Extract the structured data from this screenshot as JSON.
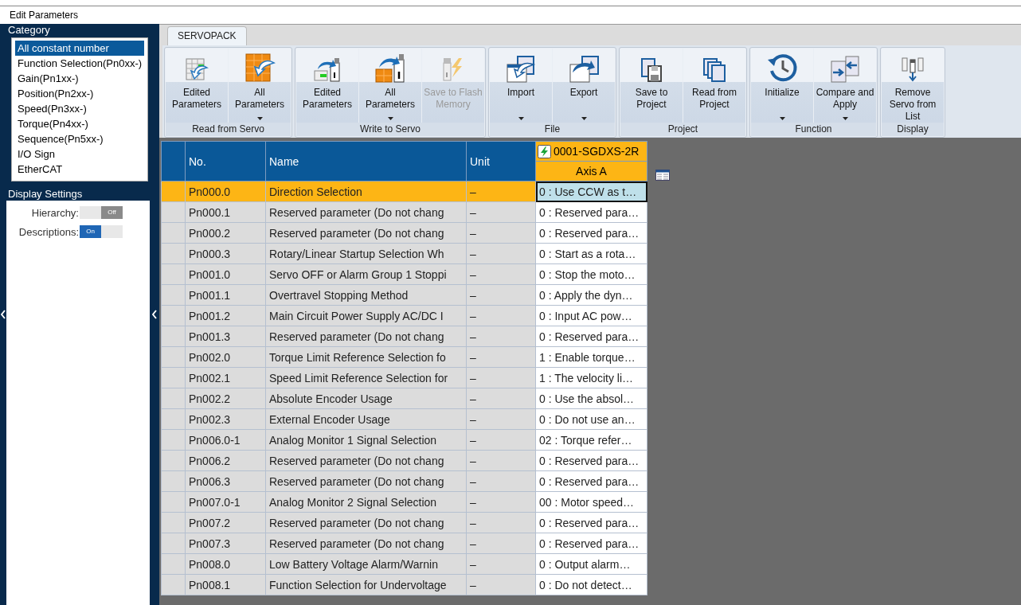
{
  "window": {
    "title": "Edit Parameters"
  },
  "sidebar": {
    "category_title": "Category",
    "categories": [
      {
        "label": "All constant number",
        "selected": true
      },
      {
        "label": "Function Selection(Pn0xx-)",
        "selected": false
      },
      {
        "label": "Gain(Pn1xx-)",
        "selected": false
      },
      {
        "label": "Position(Pn2xx-)",
        "selected": false
      },
      {
        "label": "Speed(Pn3xx-)",
        "selected": false
      },
      {
        "label": "Torque(Pn4xx-)",
        "selected": false
      },
      {
        "label": "Sequence(Pn5xx-)",
        "selected": false
      },
      {
        "label": "I/O Sign",
        "selected": false
      },
      {
        "label": "EtherCAT",
        "selected": false
      }
    ],
    "settings_title": "Display Settings",
    "settings": [
      {
        "label": "Hierarchy:",
        "on": false,
        "text": "Off"
      },
      {
        "label": "Descriptions:",
        "on": true,
        "text": "On"
      }
    ]
  },
  "ribbon": {
    "tabs": [
      {
        "label": "SERVOPACK",
        "selected": true
      }
    ],
    "groups": [
      {
        "label": "Read from Servo",
        "buttons": [
          {
            "label": "Edited Parameters",
            "has_menu": false,
            "disabled": false
          },
          {
            "label": "All Parameters",
            "has_menu": true,
            "disabled": false
          }
        ]
      },
      {
        "label": "Write to Servo",
        "buttons": [
          {
            "label": "Edited Parameters",
            "has_menu": false,
            "disabled": false
          },
          {
            "label": "All Parameters",
            "has_menu": true,
            "disabled": false
          },
          {
            "label": "Save to Flash Memory",
            "has_menu": false,
            "disabled": true
          }
        ]
      },
      {
        "label": "File",
        "buttons": [
          {
            "label": "Import",
            "has_menu": true,
            "disabled": false
          },
          {
            "label": "Export",
            "has_menu": true,
            "disabled": false
          }
        ]
      },
      {
        "label": "Project",
        "buttons": [
          {
            "label": "Save to Project",
            "has_menu": false,
            "disabled": false
          },
          {
            "label": "Read from Project",
            "has_menu": false,
            "disabled": false
          }
        ]
      },
      {
        "label": "Function",
        "buttons": [
          {
            "label": "Initialize",
            "has_menu": true,
            "disabled": false
          },
          {
            "label": "Compare and Apply",
            "has_menu": true,
            "disabled": false
          }
        ]
      },
      {
        "label": "Display",
        "buttons": [
          {
            "label": "Remove Servo from List",
            "has_menu": false,
            "disabled": false
          }
        ]
      }
    ]
  },
  "table": {
    "columns": [
      "No.",
      "Name",
      "Unit"
    ],
    "device": "0001-SGDXS-2R",
    "axis": "Axis A",
    "rows": [
      {
        "no": "Pn000.0",
        "name": "Direction Selection",
        "unit": "–",
        "value": "0 : Use CCW as t…",
        "selected": true
      },
      {
        "no": "Pn000.1",
        "name": "Reserved parameter (Do not chang",
        "unit": "–",
        "value": "0 : Reserved para…",
        "selected": false
      },
      {
        "no": "Pn000.2",
        "name": "Reserved parameter (Do not chang",
        "unit": "–",
        "value": "0 : Reserved para…",
        "selected": false
      },
      {
        "no": "Pn000.3",
        "name": "Rotary/Linear Startup Selection Wh",
        "unit": "–",
        "value": "0 : Start as a rota…",
        "selected": false
      },
      {
        "no": "Pn001.0",
        "name": "Servo OFF or Alarm Group 1 Stoppi",
        "unit": "–",
        "value": "0 : Stop the moto…",
        "selected": false
      },
      {
        "no": "Pn001.1",
        "name": "Overtravel Stopping Method",
        "unit": "–",
        "value": "0 : Apply the dyn…",
        "selected": false
      },
      {
        "no": "Pn001.2",
        "name": "Main Circuit Power Supply AC/DC I",
        "unit": "–",
        "value": "0 : Input AC pow…",
        "selected": false
      },
      {
        "no": "Pn001.3",
        "name": "Reserved parameter (Do not chang",
        "unit": "–",
        "value": "0 : Reserved para…",
        "selected": false
      },
      {
        "no": "Pn002.0",
        "name": "Torque Limit Reference Selection fo",
        "unit": "–",
        "value": "1 : Enable torque…",
        "selected": false
      },
      {
        "no": "Pn002.1",
        "name": "Speed Limit Reference Selection for",
        "unit": "–",
        "value": "1 : The velocity li…",
        "selected": false
      },
      {
        "no": "Pn002.2",
        "name": "Absolute Encoder Usage",
        "unit": "–",
        "value": "0 : Use the absol…",
        "selected": false
      },
      {
        "no": "Pn002.3",
        "name": "External Encoder Usage",
        "unit": "–",
        "value": "0 : Do not use an…",
        "selected": false
      },
      {
        "no": "Pn006.0-1",
        "name": "Analog Monitor 1 Signal Selection",
        "unit": "–",
        "value": "02 : Torque refer…",
        "selected": false
      },
      {
        "no": "Pn006.2",
        "name": "Reserved parameter (Do not chang",
        "unit": "–",
        "value": "0 : Reserved para…",
        "selected": false
      },
      {
        "no": "Pn006.3",
        "name": "Reserved parameter (Do not chang",
        "unit": "–",
        "value": "0 : Reserved para…",
        "selected": false
      },
      {
        "no": "Pn007.0-1",
        "name": "Analog Monitor 2 Signal Selection",
        "unit": "–",
        "value": "00 : Motor speed…",
        "selected": false
      },
      {
        "no": "Pn007.2",
        "name": "Reserved parameter (Do not chang",
        "unit": "–",
        "value": "0 : Reserved para…",
        "selected": false
      },
      {
        "no": "Pn007.3",
        "name": "Reserved parameter (Do not chang",
        "unit": "–",
        "value": "0 : Reserved para…",
        "selected": false
      },
      {
        "no": "Pn008.0",
        "name": "Low Battery Voltage Alarm/Warnin",
        "unit": "–",
        "value": "0 : Output alarm…",
        "selected": false
      },
      {
        "no": "Pn008.1",
        "name": "Function Selection for Undervoltage",
        "unit": "–",
        "value": "0 : Do not detect…",
        "selected": false
      }
    ]
  }
}
